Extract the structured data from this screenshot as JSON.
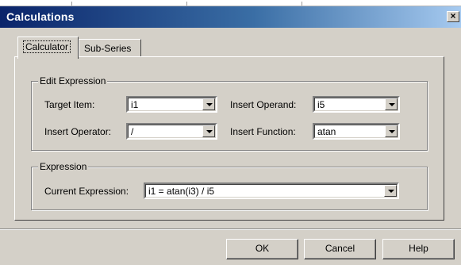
{
  "window": {
    "title": "Calculations",
    "close_label": "×"
  },
  "tabs": [
    {
      "label": "Calculator"
    },
    {
      "label": "Sub-Series"
    }
  ],
  "edit_expression": {
    "group_title": "Edit Expression",
    "target_item": {
      "label": "Target Item:",
      "value": "i1"
    },
    "insert_operand": {
      "label": "Insert Operand:",
      "value": "i5"
    },
    "insert_operator": {
      "label": "Insert Operator:",
      "value": "/"
    },
    "insert_function": {
      "label": "Insert Function:",
      "value": "atan"
    }
  },
  "expression": {
    "group_title": "Expression",
    "current_expression": {
      "label": "Current Expression:",
      "value": "i1 =  atan(i3) / i5"
    }
  },
  "buttons": {
    "ok": "OK",
    "cancel": "Cancel",
    "help": "Help"
  },
  "colors": {
    "title_gradient_start": "#0a246a",
    "title_gradient_end": "#a6caf0",
    "face": "#d4d0c8"
  }
}
